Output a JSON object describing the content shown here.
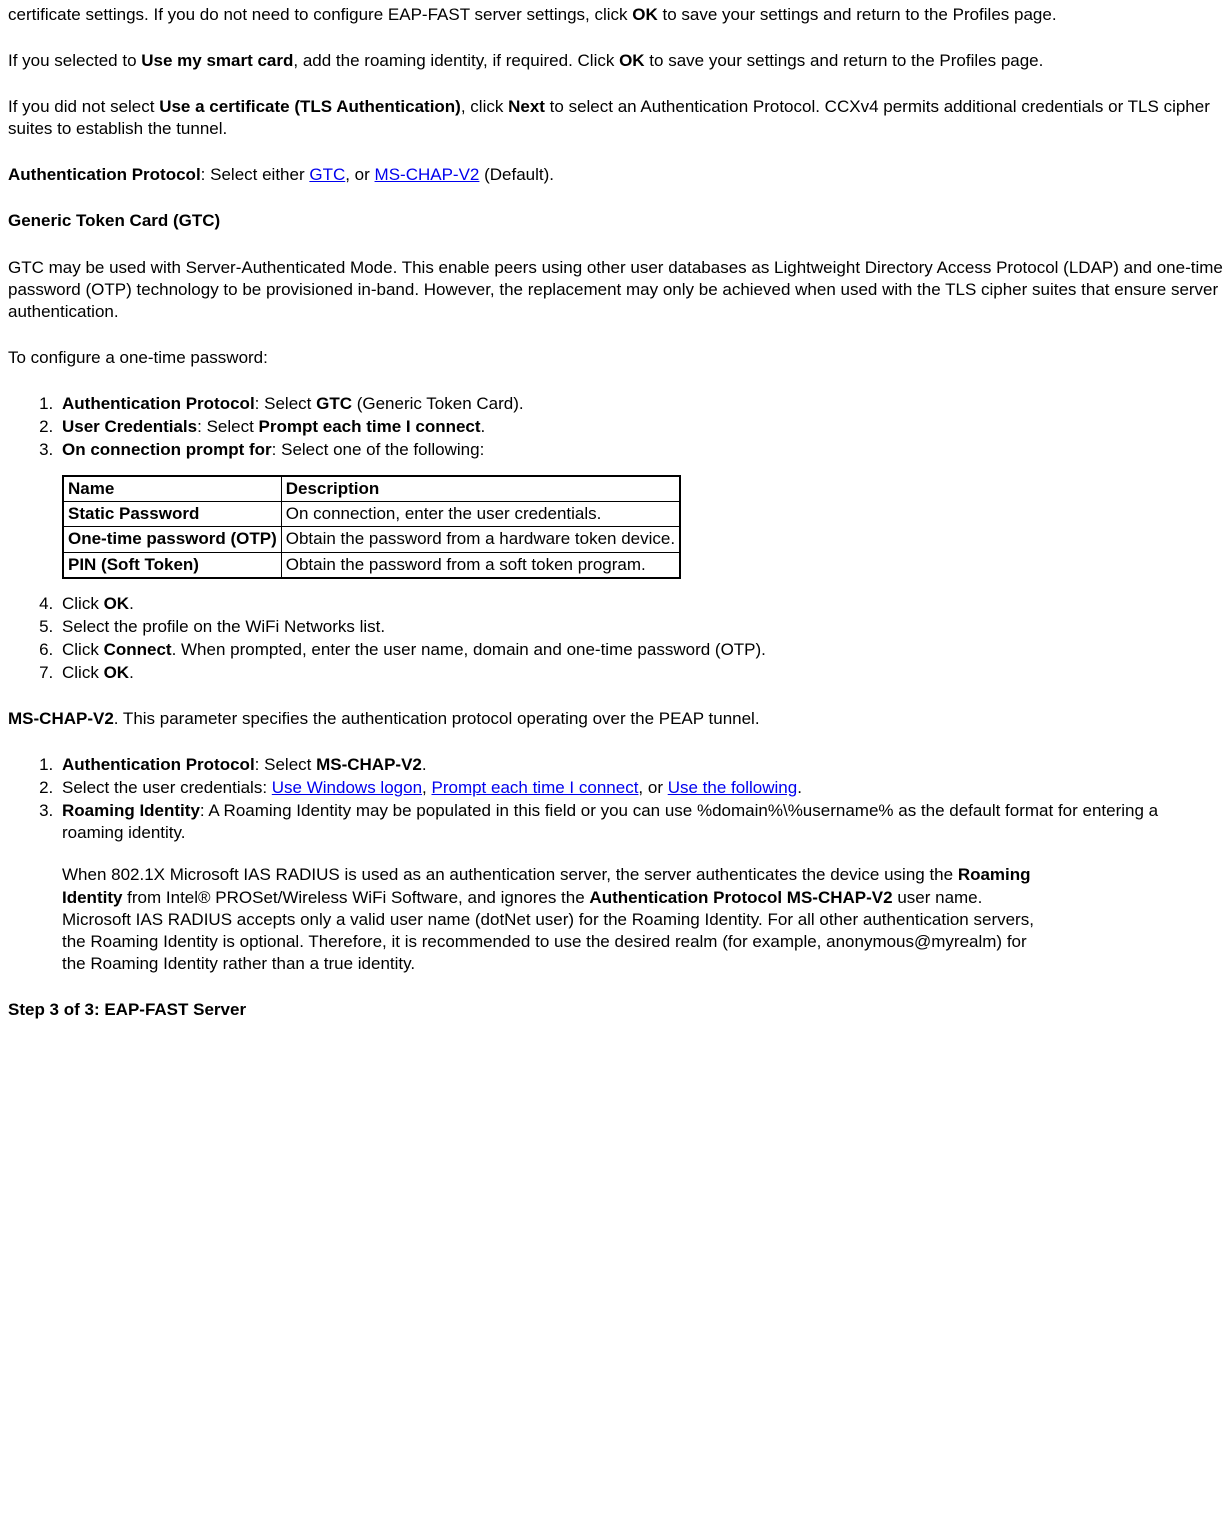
{
  "p1_a": "certificate settings. If you do not need to configure EAP-FAST server settings, click ",
  "p1_b": "OK",
  "p1_c": " to save your settings and return to the Profiles page.",
  "p2_a": "If you selected to ",
  "p2_b": "Use my smart card",
  "p2_c": ", add the roaming identity, if required. Click ",
  "p2_d": "OK",
  "p2_e": " to save your settings and return to the Profiles page.",
  "p3_a": "If you did not select ",
  "p3_b": "Use a certificate (TLS Authentication)",
  "p3_c": ", click ",
  "p3_d": "Next",
  "p3_e": " to select an Authentication Protocol. CCXv4 permits additional credentials or TLS cipher suites to establish the tunnel.",
  "p4_a": "Authentication Protocol",
  "p4_b": ": Select either ",
  "p4_link1": "GTC",
  "p4_c": ", or ",
  "p4_link2": "MS-CHAP-V2",
  "p4_d": " (Default).",
  "h_gtc": "Generic Token Card (GTC)",
  "p5": "GTC may be used with Server-Authenticated Mode. This enable peers using other user databases as Lightweight Directory Access Protocol (LDAP) and one-time password (OTP) technology to be provisioned in-band. However, the replacement may only be achieved when used with the TLS cipher suites that ensure server authentication.",
  "p6": "To configure a one-time password:",
  "ol1": [
    {
      "b": "Authentication Protocol",
      "t": ": Select ",
      "b2": "GTC",
      "t2": " (Generic Token Card)."
    },
    {
      "b": "User Credentials",
      "t": ": Select ",
      "b2": "Prompt each time I connect",
      "t2": "."
    },
    {
      "b": "On connection prompt for",
      "t": ": Select one of the following:"
    }
  ],
  "table": {
    "header": [
      "Name",
      "Description"
    ],
    "rows": [
      [
        "Static Password",
        "On connection, enter the user credentials."
      ],
      [
        "One-time password (OTP)",
        "Obtain the password from a hardware token device."
      ],
      [
        "PIN (Soft Token)",
        "Obtain the password from a soft token program."
      ]
    ]
  },
  "ol2": [
    {
      "a": "Click ",
      "b": "OK",
      "c": "."
    },
    {
      "a": "Select the profile on the WiFi Networks list."
    },
    {
      "a": "Click ",
      "b": "Connect",
      "c": ". When prompted, enter the user name, domain and one-time password (OTP)."
    },
    {
      "a": "Click ",
      "b": "OK",
      "c": "."
    }
  ],
  "p7_a": "MS-CHAP-V2",
  "p7_b": ". This parameter specifies the authentication protocol operating over the PEAP tunnel.",
  "ol3_1_a": "Authentication Protocol",
  "ol3_1_b": ": Select ",
  "ol3_1_c": "MS-CHAP-V2",
  "ol3_1_d": ".",
  "ol3_2_a": "Select the user credentials: ",
  "ol3_2_l1": "Use Windows logon",
  "ol3_2_b": ", ",
  "ol3_2_l2": "Prompt each time I connect",
  "ol3_2_c": ", or ",
  "ol3_2_l3": "Use the following",
  "ol3_2_d": ".",
  "ol3_3_a": "Roaming Identity",
  "ol3_3_b": ": A Roaming Identity may be populated in this field or you can use %domain%\\%username% as the default format for entering a roaming identity.",
  "ol3_3_p_a": "When 802.1X Microsoft IAS RADIUS is used as an authentication server, the server authenticates the device using the ",
  "ol3_3_p_b": "Roaming Identity",
  "ol3_3_p_c": " from Intel® PROSet/Wireless WiFi Software, and ignores the ",
  "ol3_3_p_d": "Authentication Protocol MS-CHAP-V2",
  "ol3_3_p_e": " user name. Microsoft IAS RADIUS accepts only a valid user name (dotNet user) for the Roaming Identity. For all other authentication servers, the Roaming Identity is optional. Therefore, it is recommended to use the desired realm (for example, anonymous@myrealm) for the Roaming Identity rather than a true identity.",
  "h_step3": "Step 3 of 3: EAP-FAST Server"
}
